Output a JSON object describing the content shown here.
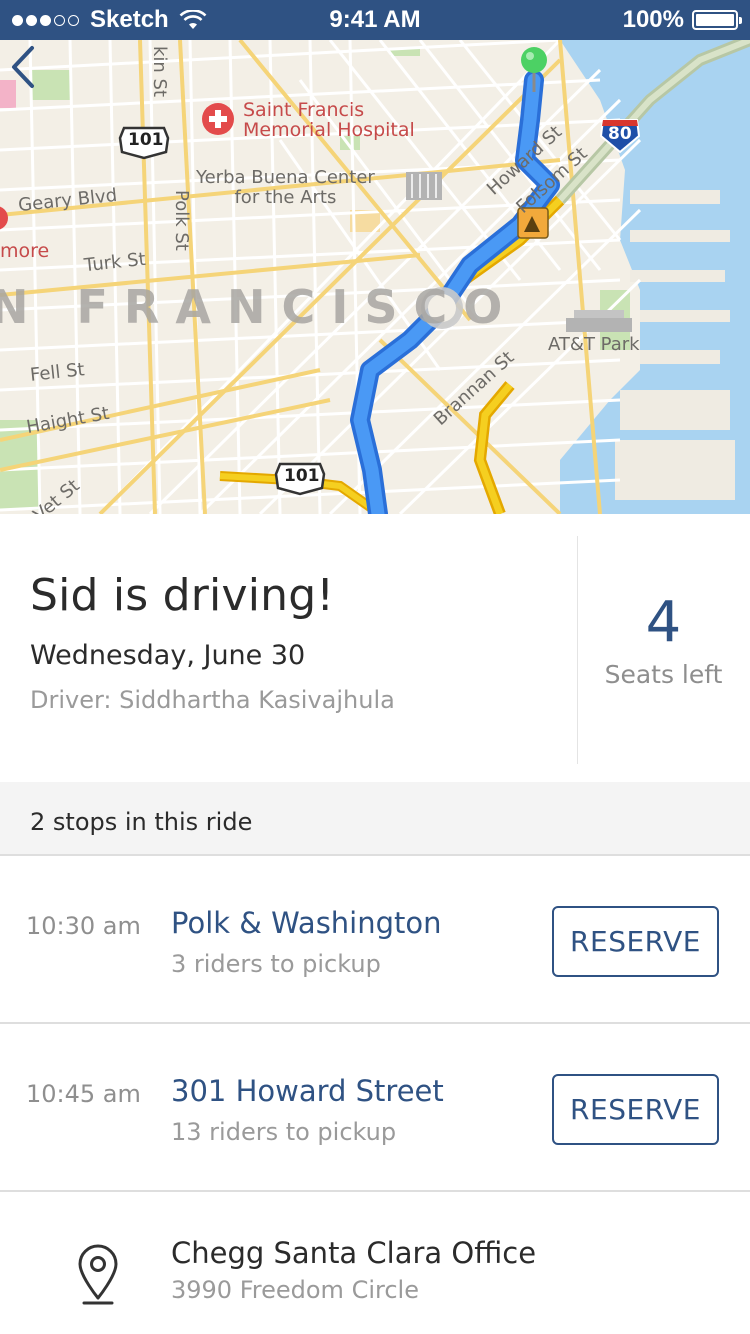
{
  "status_bar": {
    "carrier": "Sketch",
    "time": "9:41 AM",
    "battery": "100%",
    "signal_bars_filled": 3,
    "signal_bars_total": 5
  },
  "map": {
    "labels": {
      "hospital": "Saint Francis\nMemorial Hospital",
      "hospital_line1": "Saint Francis",
      "hospital_line2": "Memorial Hospital",
      "yerba_line1": "Yerba Buena Center",
      "yerba_line2": "for the Arts",
      "geary": "Geary Blvd",
      "turk": "Turk St",
      "polk": "Polk St",
      "kin": "kin St",
      "fell": "Fell St",
      "haight": "Haight St",
      "howard": "Howard St",
      "folsom": "Folsom St",
      "brannan": "Brannan St",
      "att_park": "AT&T Park",
      "more": "more",
      "city": "N FRANCISCO",
      "vet": "Vet St",
      "hwy_101_top": "101",
      "hwy_101_bottom": "101",
      "hwy_80": "80"
    },
    "colors": {
      "route": "#3f8ef2",
      "traffic": "#f2c21b",
      "water": "#a9d3f1",
      "pin": "#4cd164"
    }
  },
  "ride": {
    "title": "Sid is driving!",
    "date": "Wednesday, June 30",
    "driver": "Driver: Siddhartha Kasivajhula",
    "seats_count": "4",
    "seats_label": "Seats left"
  },
  "stops_header": "2 stops in this ride",
  "stops": [
    {
      "time": "10:30 am",
      "name": "Polk & Washington",
      "riders": "3 riders to pickup",
      "action": "RESERVE"
    },
    {
      "time": "10:45 am",
      "name": "301 Howard Street",
      "riders": "13 riders to pickup",
      "action": "RESERVE"
    }
  ],
  "destination": {
    "name": "Chegg Santa Clara Office",
    "address": "3990 Freedom Circle",
    "icon": "location-pin-icon"
  },
  "accent_color": "#2f5283"
}
